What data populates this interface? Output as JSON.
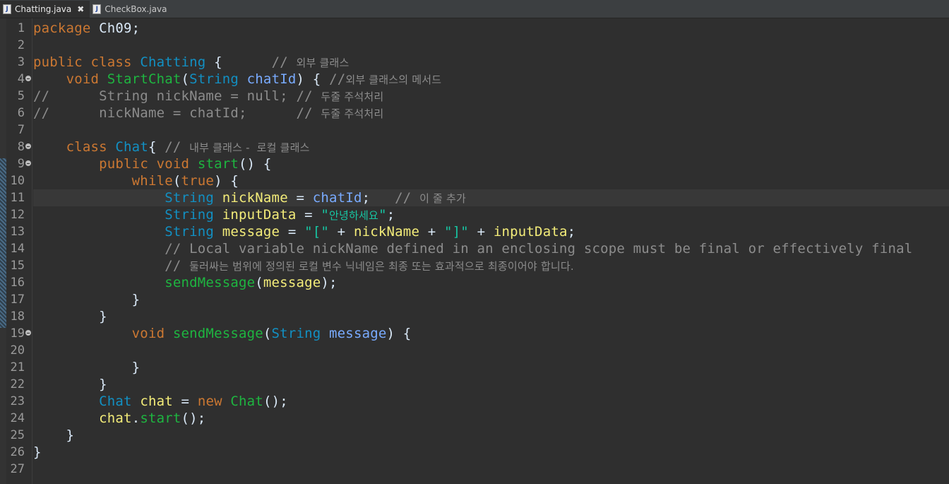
{
  "tabs": [
    {
      "label": "Chatting.java",
      "active": true,
      "close": "✖"
    },
    {
      "label": "CheckBox.java",
      "active": false
    }
  ],
  "file_icon_letter": "J",
  "current_line": 11,
  "lines": [
    {
      "n": "1",
      "fold": false,
      "tokens": [
        [
          "kw",
          "package"
        ],
        [
          "pl",
          " Ch09;"
        ]
      ]
    },
    {
      "n": "2",
      "fold": false,
      "tokens": []
    },
    {
      "n": "3",
      "fold": false,
      "tokens": [
        [
          "kw",
          "public"
        ],
        [
          "pl",
          " "
        ],
        [
          "kw",
          "class"
        ],
        [
          "pl",
          " "
        ],
        [
          "ty",
          "Chatting"
        ],
        [
          "pl",
          " {      "
        ],
        [
          "cm",
          "// "
        ],
        [
          "cmk",
          "외부 클래스"
        ]
      ]
    },
    {
      "n": "4",
      "fold": true,
      "tokens": [
        [
          "pl",
          "    "
        ],
        [
          "kw",
          "void"
        ],
        [
          "pl",
          " "
        ],
        [
          "fn",
          "StartChat"
        ],
        [
          "pl",
          "("
        ],
        [
          "ty",
          "String"
        ],
        [
          "pl",
          " "
        ],
        [
          "par",
          "chatId"
        ],
        [
          "pl",
          ") { "
        ],
        [
          "cm",
          "//"
        ],
        [
          "cmk",
          "외부 클래스의 메서드"
        ]
      ]
    },
    {
      "n": "5",
      "fold": false,
      "tokens": [
        [
          "cm",
          "//      String nickName = null; // "
        ],
        [
          "cmk",
          "두줄 주석처리"
        ]
      ]
    },
    {
      "n": "6",
      "fold": false,
      "tokens": [
        [
          "cm",
          "//      nickName = chatId;      // "
        ],
        [
          "cmk",
          "두줄 주석처리"
        ]
      ]
    },
    {
      "n": "7",
      "fold": false,
      "tokens": []
    },
    {
      "n": "8",
      "fold": true,
      "tokens": [
        [
          "pl",
          "    "
        ],
        [
          "kw",
          "class"
        ],
        [
          "pl",
          " "
        ],
        [
          "ty",
          "Chat"
        ],
        [
          "pl",
          "{ "
        ],
        [
          "cm",
          "// "
        ],
        [
          "cmk",
          "내부 클래스 -  로컬 클래스"
        ]
      ]
    },
    {
      "n": "9",
      "fold": true,
      "tokens": [
        [
          "pl",
          "        "
        ],
        [
          "kw",
          "public"
        ],
        [
          "pl",
          " "
        ],
        [
          "kw",
          "void"
        ],
        [
          "pl",
          " "
        ],
        [
          "fn",
          "start"
        ],
        [
          "pl",
          "() {"
        ]
      ]
    },
    {
      "n": "10",
      "fold": false,
      "tokens": [
        [
          "pl",
          "            "
        ],
        [
          "kw",
          "while"
        ],
        [
          "pl",
          "("
        ],
        [
          "kw",
          "true"
        ],
        [
          "pl",
          ") {"
        ]
      ]
    },
    {
      "n": "11",
      "fold": false,
      "tokens": [
        [
          "pl",
          "                "
        ],
        [
          "ty",
          "String"
        ],
        [
          "pl",
          " "
        ],
        [
          "var",
          "nickName"
        ],
        [
          "pl",
          " = "
        ],
        [
          "par",
          "chatId"
        ],
        [
          "pl",
          ";   "
        ],
        [
          "cm",
          "// "
        ],
        [
          "cmk",
          "이 줄 추가"
        ]
      ]
    },
    {
      "n": "12",
      "fold": false,
      "tokens": [
        [
          "pl",
          "                "
        ],
        [
          "ty",
          "String"
        ],
        [
          "pl",
          " "
        ],
        [
          "var",
          "inputData"
        ],
        [
          "pl",
          " = "
        ],
        [
          "str",
          "\""
        ],
        [
          "strk",
          "안녕하세요"
        ],
        [
          "str",
          "\""
        ],
        [
          "pl",
          ";"
        ]
      ]
    },
    {
      "n": "13",
      "fold": false,
      "tokens": [
        [
          "pl",
          "                "
        ],
        [
          "ty",
          "String"
        ],
        [
          "pl",
          " "
        ],
        [
          "var",
          "message"
        ],
        [
          "pl",
          " = "
        ],
        [
          "str",
          "\"[\""
        ],
        [
          "pl",
          " + "
        ],
        [
          "var",
          "nickName"
        ],
        [
          "pl",
          " + "
        ],
        [
          "str",
          "\"]\""
        ],
        [
          "pl",
          " + "
        ],
        [
          "var",
          "inputData"
        ],
        [
          "pl",
          ";"
        ]
      ]
    },
    {
      "n": "14",
      "fold": false,
      "tokens": [
        [
          "pl",
          "                "
        ],
        [
          "cm",
          "// Local variable nickName defined in an enclosing scope must be final or effectively final"
        ]
      ]
    },
    {
      "n": "15",
      "fold": false,
      "tokens": [
        [
          "pl",
          "                "
        ],
        [
          "cm",
          "// "
        ],
        [
          "cmk",
          "둘러싸는 범위에 정의된 로컬 변수 닉네임은 최종 또는 효과적으로 최종이어야 합니다."
        ]
      ]
    },
    {
      "n": "16",
      "fold": false,
      "tokens": [
        [
          "pl",
          "                "
        ],
        [
          "fn",
          "sendMessage"
        ],
        [
          "pl",
          "("
        ],
        [
          "var",
          "message"
        ],
        [
          "pl",
          ");"
        ]
      ]
    },
    {
      "n": "17",
      "fold": false,
      "tokens": [
        [
          "pl",
          "            }"
        ]
      ]
    },
    {
      "n": "18",
      "fold": false,
      "tokens": [
        [
          "pl",
          "        }"
        ]
      ]
    },
    {
      "n": "19",
      "fold": true,
      "tokens": [
        [
          "pl",
          "            "
        ],
        [
          "kw",
          "void"
        ],
        [
          "pl",
          " "
        ],
        [
          "fn",
          "sendMessage"
        ],
        [
          "pl",
          "("
        ],
        [
          "ty",
          "String"
        ],
        [
          "pl",
          " "
        ],
        [
          "par",
          "message"
        ],
        [
          "pl",
          ") {"
        ]
      ]
    },
    {
      "n": "20",
      "fold": false,
      "tokens": []
    },
    {
      "n": "21",
      "fold": false,
      "tokens": [
        [
          "pl",
          "            }"
        ]
      ]
    },
    {
      "n": "22",
      "fold": false,
      "tokens": [
        [
          "pl",
          "        }"
        ]
      ]
    },
    {
      "n": "23",
      "fold": false,
      "tokens": [
        [
          "pl",
          "        "
        ],
        [
          "ty",
          "Chat"
        ],
        [
          "pl",
          " "
        ],
        [
          "var",
          "chat"
        ],
        [
          "pl",
          " = "
        ],
        [
          "kw",
          "new"
        ],
        [
          "pl",
          " "
        ],
        [
          "fn",
          "Chat"
        ],
        [
          "pl",
          "();"
        ]
      ]
    },
    {
      "n": "24",
      "fold": false,
      "tokens": [
        [
          "pl",
          "        "
        ],
        [
          "var",
          "chat"
        ],
        [
          "pl",
          "."
        ],
        [
          "fn",
          "start"
        ],
        [
          "pl",
          "();"
        ]
      ]
    },
    {
      "n": "25",
      "fold": false,
      "tokens": [
        [
          "pl",
          "    }"
        ]
      ]
    },
    {
      "n": "26",
      "fold": false,
      "tokens": [
        [
          "pl",
          "}"
        ]
      ]
    },
    {
      "n": "27",
      "fold": false,
      "tokens": []
    }
  ]
}
